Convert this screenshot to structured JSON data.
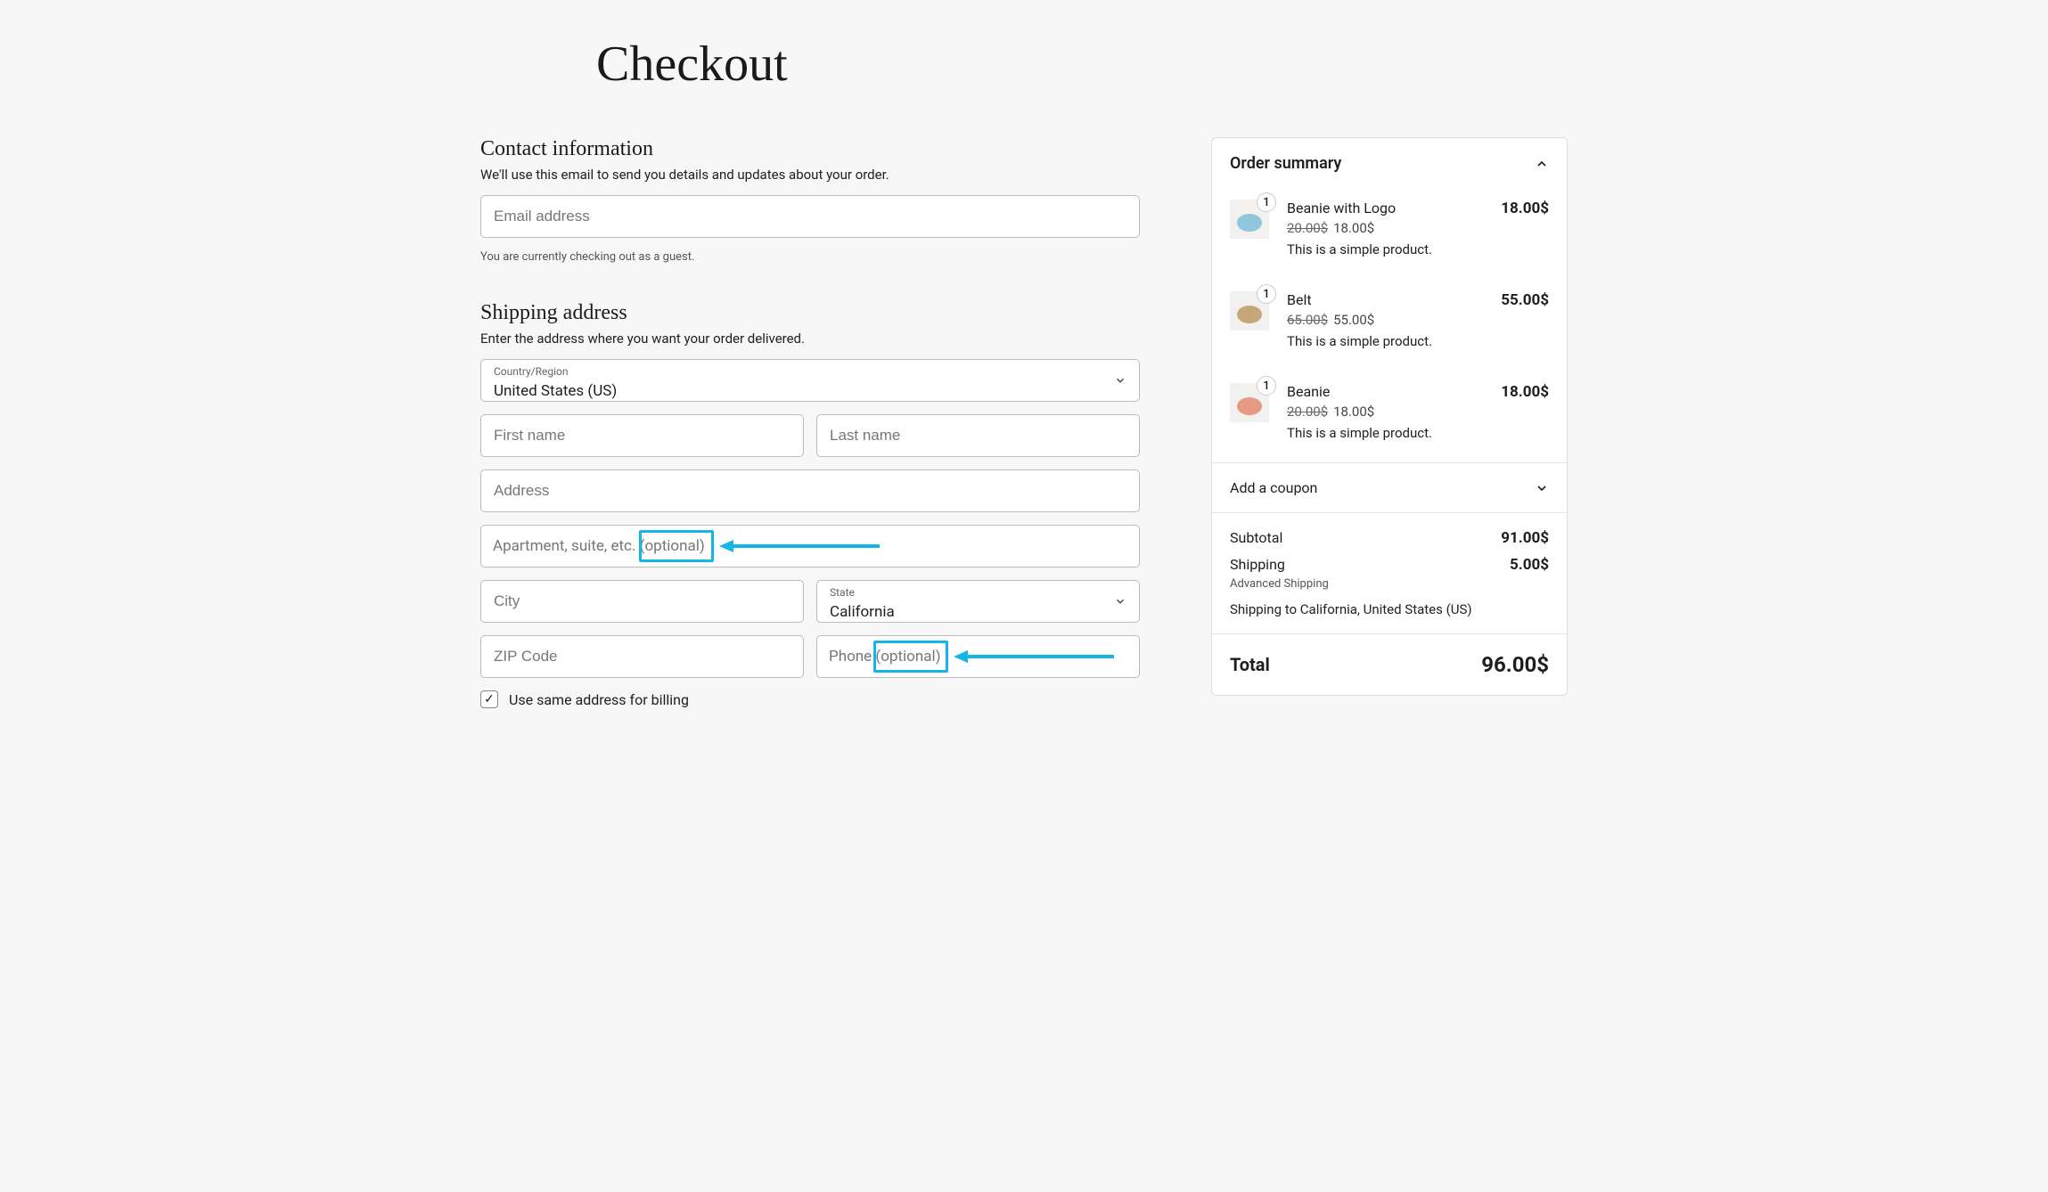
{
  "page": {
    "title": "Checkout"
  },
  "contact": {
    "heading": "Contact information",
    "sub": "We'll use this email to send you details and updates about your order.",
    "email_placeholder": "Email address",
    "guest_hint": "You are currently checking out as a guest."
  },
  "shipping": {
    "heading": "Shipping address",
    "sub": "Enter the address where you want your order delivered.",
    "country_label": "Country/Region",
    "country_value": "United States (US)",
    "first_name_placeholder": "First name",
    "last_name_placeholder": "Last name",
    "address_placeholder": "Address",
    "apt_placeholder_main": "Apartment, suite, etc. ",
    "apt_placeholder_optional": "(optional)",
    "city_placeholder": "City",
    "state_label": "State",
    "state_value": "California",
    "zip_placeholder": "ZIP Code",
    "phone_placeholder_main": "Phone ",
    "phone_placeholder_optional": "(optional)",
    "same_for_billing_label": "Use same address for billing",
    "same_for_billing_checked": true
  },
  "summary": {
    "heading": "Order summary",
    "items": [
      {
        "name": "Beanie with Logo",
        "qty": "1",
        "old_price": "20.00$",
        "price": "18.00$",
        "total": "18.00$",
        "desc": "This is a simple product.",
        "thumb_color": "#8fc7de"
      },
      {
        "name": "Belt",
        "qty": "1",
        "old_price": "65.00$",
        "price": "55.00$",
        "total": "55.00$",
        "desc": "This is a simple product.",
        "thumb_color": "#c7a77a"
      },
      {
        "name": "Beanie",
        "qty": "1",
        "old_price": "20.00$",
        "price": "18.00$",
        "total": "18.00$",
        "desc": "This is a simple product.",
        "thumb_color": "#e79a82"
      }
    ],
    "coupon_label": "Add a coupon",
    "subtotal_label": "Subtotal",
    "subtotal_value": "91.00$",
    "shipping_label": "Shipping",
    "shipping_value": "5.00$",
    "shipping_method": "Advanced Shipping",
    "shipping_to": "Shipping to California, United States (US)",
    "total_label": "Total",
    "total_value": "96.00$"
  },
  "annotations": {
    "arrow_color": "#12b7e6"
  }
}
